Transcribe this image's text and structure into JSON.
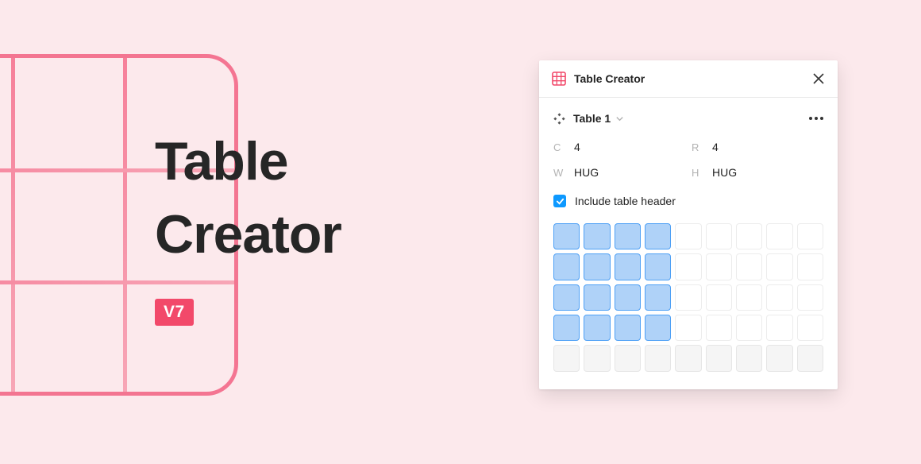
{
  "colors": {
    "accent_pink": "#f2496a",
    "accent_blue": "#0d99ff",
    "cell_selected_fill": "#afd2f8",
    "cell_selected_border": "#4ea0f5"
  },
  "hero": {
    "title_line1": "Table",
    "title_line2": "Creator",
    "version_badge": "V7"
  },
  "panel": {
    "title": "Table Creator",
    "table_name": "Table 1",
    "props": {
      "columns_label": "C",
      "columns_value": "4",
      "rows_label": "R",
      "rows_value": "4",
      "width_label": "W",
      "width_value": "HUG",
      "height_label": "H",
      "height_value": "HUG"
    },
    "include_header": {
      "checked": true,
      "label": "Include table header"
    },
    "grid": {
      "total_cols": 9,
      "visible_rows": 5,
      "selected_cols": 4,
      "selected_rows": 4
    }
  }
}
